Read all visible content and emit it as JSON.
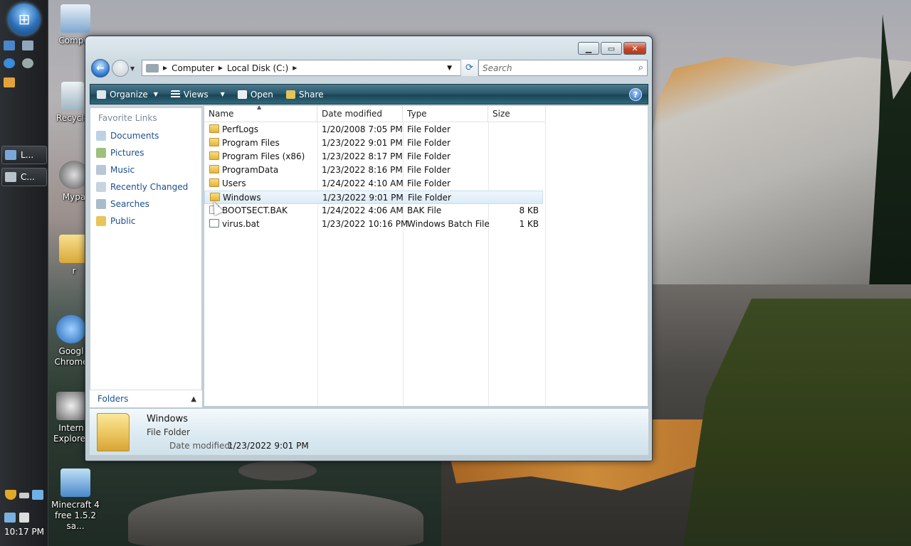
{
  "desktop": {
    "icons": [
      {
        "label": "Computer",
        "display": "Comput"
      },
      {
        "label": "Recycle Bin",
        "display": "Recycle"
      },
      {
        "label": "Mypal",
        "display": "Mypa"
      },
      {
        "label": "r",
        "display": "r"
      },
      {
        "label": "Google Chrome",
        "display": "Googl Chrome"
      },
      {
        "label": "Internet Explorer",
        "display": "Intern Explorer"
      },
      {
        "label": "Minecraft 4 free 1.5.2 sa...",
        "display": "Minecraft 4 free 1.5.2 sa..."
      }
    ]
  },
  "sidebar": {
    "tasks": [
      {
        "label": "L..."
      },
      {
        "label": "C..."
      }
    ],
    "clock": "10:17 PM"
  },
  "window": {
    "address": {
      "crumbs": [
        "Computer",
        "Local Disk (C:)"
      ]
    },
    "search": {
      "placeholder": "Search"
    },
    "toolbar": {
      "organize": "Organize",
      "views": "Views",
      "open": "Open",
      "share": "Share",
      "help": "?"
    },
    "nav": {
      "header": "Favorite Links",
      "links": [
        "Documents",
        "Pictures",
        "Music",
        "Recently Changed",
        "Searches",
        "Public"
      ],
      "folders": "Folders"
    },
    "columns": {
      "name": "Name",
      "date": "Date modified",
      "type": "Type",
      "size": "Size"
    },
    "files": [
      {
        "name": "PerfLogs",
        "date": "1/20/2008 7:05 PM",
        "type": "File Folder",
        "size": "",
        "kind": "folder"
      },
      {
        "name": "Program Files",
        "date": "1/23/2022 9:01 PM",
        "type": "File Folder",
        "size": "",
        "kind": "folder"
      },
      {
        "name": "Program Files (x86)",
        "date": "1/23/2022 8:17 PM",
        "type": "File Folder",
        "size": "",
        "kind": "folder"
      },
      {
        "name": "ProgramData",
        "date": "1/23/2022 8:16 PM",
        "type": "File Folder",
        "size": "",
        "kind": "folder"
      },
      {
        "name": "Users",
        "date": "1/24/2022 4:10 AM",
        "type": "File Folder",
        "size": "",
        "kind": "folder"
      },
      {
        "name": "Windows",
        "date": "1/23/2022 9:01 PM",
        "type": "File Folder",
        "size": "",
        "kind": "folder",
        "selected": true
      },
      {
        "name": "BOOTSECT.BAK",
        "date": "1/24/2022 4:06 AM",
        "type": "BAK File",
        "size": "8 KB",
        "kind": "bak"
      },
      {
        "name": "virus.bat",
        "date": "1/23/2022 10:16 PM",
        "type": "Windows Batch File",
        "size": "1 KB",
        "kind": "bat"
      }
    ],
    "details": {
      "name": "Windows",
      "type": "File Folder",
      "modified_label": "Date modified:",
      "modified_value": "1/23/2022 9:01 PM"
    }
  }
}
